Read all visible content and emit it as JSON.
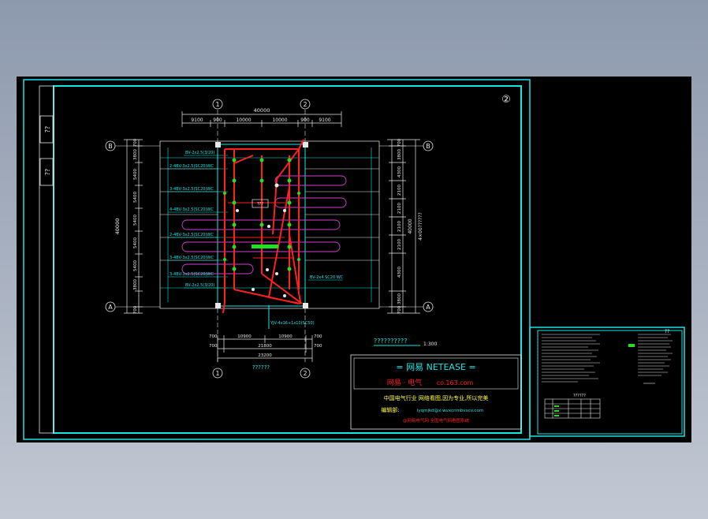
{
  "colors": {
    "background": "#000000",
    "frame": "#18e6e6",
    "wiring": "#ff2020",
    "fixtures": "#20e020",
    "beam_loops": "#d040d0",
    "dimension": "#e8e8e8",
    "text_cyan": "#18e6e6"
  },
  "sheet_number": "②",
  "side_labels": [
    "??",
    "??"
  ],
  "axes": {
    "col_1": "1",
    "col_2": "2",
    "row_a_left": "A",
    "row_b_left": "B",
    "row_a_right": "A",
    "row_b_right": "B"
  },
  "dims_top": {
    "overall": "40000",
    "segments": [
      "9100",
      "900",
      "10000",
      "10000",
      "900",
      "9100"
    ]
  },
  "dims_left": {
    "overall": "40000",
    "segments": [
      "700",
      "3800",
      "5400",
      "5400",
      "5400",
      "5400",
      "5400",
      "3800",
      "700"
    ]
  },
  "dims_right": {
    "overall": "40000",
    "note": "4×00??????",
    "outer": [
      "700",
      "3800",
      "4300",
      "2100",
      "2100",
      "2100",
      "2100",
      "4300",
      "3800",
      "700"
    ]
  },
  "dims_bottom": {
    "row1": [
      "700",
      "10900",
      "10900",
      "700"
    ],
    "row2": [
      "700",
      "21800",
      "700"
    ],
    "row3": "23200"
  },
  "plan_title": "??????",
  "scale_caption": {
    "label": "??????????",
    "ratio": "1:300"
  },
  "circuit_labels": [
    "BV-2x2.5(3/20)",
    "2-4BV-3x2.5(SC20)WC",
    "3-4BV-3x2.5(SC20)WC",
    "4-4BV-3x2.5(SC20)WC",
    "2-4BV-3x2.5(SC20)WC",
    "3-4BV-3x2.5(SC20)WC",
    "3-4BV-3x2.5(SC20)WC",
    "BV-2x2.5(3/20)"
  ],
  "right_label": "BV-2x4 SC20 WC",
  "bottom_label": "YJV-4x16+1x10(SC50)",
  "box_label": "???",
  "title_block": {
    "banner": "= 网易 NETEASE =",
    "sub1": "网易 · 电气",
    "sub2": "co.163.com",
    "line1": "中国电气行业 网络看图,因为专业,所以完美",
    "line2_label": "编辑部:",
    "line2_value": "lyqmjkd@x·wvxcnmbvxcv.com",
    "line3": "@网易电气网 全国电气网看图系统"
  },
  "legend_title": "??????",
  "legend_note": "??"
}
